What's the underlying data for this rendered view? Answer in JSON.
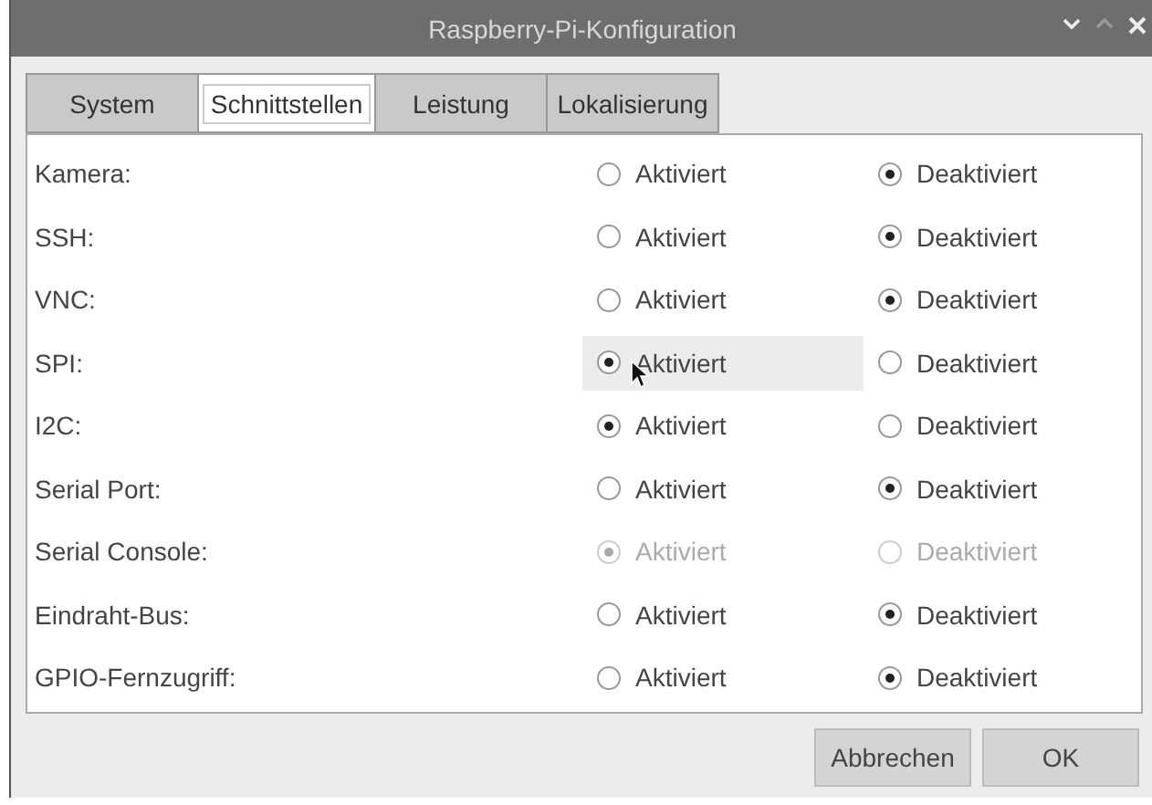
{
  "window": {
    "title": "Raspberry-Pi-Konfiguration"
  },
  "tabs": [
    {
      "label": "System",
      "selected": false
    },
    {
      "label": "Schnittstellen",
      "selected": true
    },
    {
      "label": "Leistung",
      "selected": false
    },
    {
      "label": "Lokalisierung",
      "selected": false
    }
  ],
  "rows": [
    {
      "label": "Kamera:",
      "disabled": false,
      "options": [
        {
          "label": "Aktiviert",
          "selected": false,
          "highlighted": false
        },
        {
          "label": "Deaktiviert",
          "selected": true,
          "highlighted": false
        }
      ]
    },
    {
      "label": "SSH:",
      "disabled": false,
      "options": [
        {
          "label": "Aktiviert",
          "selected": false,
          "highlighted": false
        },
        {
          "label": "Deaktiviert",
          "selected": true,
          "highlighted": false
        }
      ]
    },
    {
      "label": "VNC:",
      "disabled": false,
      "options": [
        {
          "label": "Aktiviert",
          "selected": false,
          "highlighted": false
        },
        {
          "label": "Deaktiviert",
          "selected": true,
          "highlighted": false
        }
      ]
    },
    {
      "label": "SPI:",
      "disabled": false,
      "options": [
        {
          "label": "Aktiviert",
          "selected": true,
          "highlighted": true
        },
        {
          "label": "Deaktiviert",
          "selected": false,
          "highlighted": false
        }
      ]
    },
    {
      "label": "I2C:",
      "disabled": false,
      "options": [
        {
          "label": "Aktiviert",
          "selected": true,
          "highlighted": false
        },
        {
          "label": "Deaktiviert",
          "selected": false,
          "highlighted": false
        }
      ]
    },
    {
      "label": "Serial Port:",
      "disabled": false,
      "options": [
        {
          "label": "Aktiviert",
          "selected": false,
          "highlighted": false
        },
        {
          "label": "Deaktiviert",
          "selected": true,
          "highlighted": false
        }
      ]
    },
    {
      "label": "Serial Console:",
      "disabled": true,
      "options": [
        {
          "label": "Aktiviert",
          "selected": true,
          "highlighted": false
        },
        {
          "label": "Deaktiviert",
          "selected": false,
          "highlighted": false
        }
      ]
    },
    {
      "label": "Eindraht-Bus:",
      "disabled": false,
      "options": [
        {
          "label": "Aktiviert",
          "selected": false,
          "highlighted": false
        },
        {
          "label": "Deaktiviert",
          "selected": true,
          "highlighted": false
        }
      ]
    },
    {
      "label": "GPIO-Fernzugriff:",
      "disabled": false,
      "options": [
        {
          "label": "Aktiviert",
          "selected": false,
          "highlighted": false
        },
        {
          "label": "Deaktiviert",
          "selected": true,
          "highlighted": false
        }
      ]
    }
  ],
  "buttons": [
    "Abbrechen",
    "OK"
  ]
}
